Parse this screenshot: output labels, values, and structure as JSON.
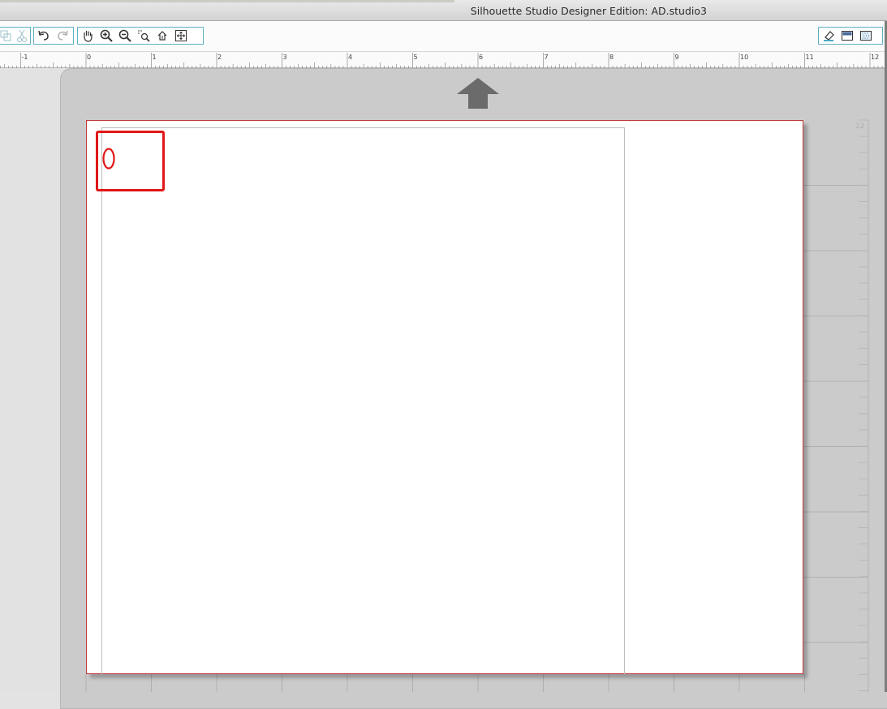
{
  "window": {
    "title": "Silhouette Studio Designer Edition: AD.studio3"
  },
  "toolbar": {
    "left_group": [
      "duplicate-icon",
      "cut-icon"
    ],
    "history_group": [
      "undo-icon",
      "redo-icon"
    ],
    "view_group": [
      "pan-hand-icon",
      "zoom-in-icon",
      "zoom-out-icon",
      "zoom-select-icon",
      "zoom-drag-icon",
      "fit-to-page-icon"
    ],
    "right_group": [
      "eraser-icon",
      "fill-color-icon",
      "fill-pattern-icon"
    ]
  },
  "ruler": {
    "labels": [
      "-1",
      "0",
      "1",
      "2",
      "3",
      "4",
      "5",
      "6",
      "7",
      "8",
      "9",
      "10",
      "11",
      "12"
    ]
  },
  "mat": {
    "side_ruler_label": "12"
  },
  "colors": {
    "toolbar_border": "#5fb0c2",
    "page_border": "#c23a3a",
    "annotation": "#e01818",
    "feed_arrow": "#6b6b6b"
  }
}
